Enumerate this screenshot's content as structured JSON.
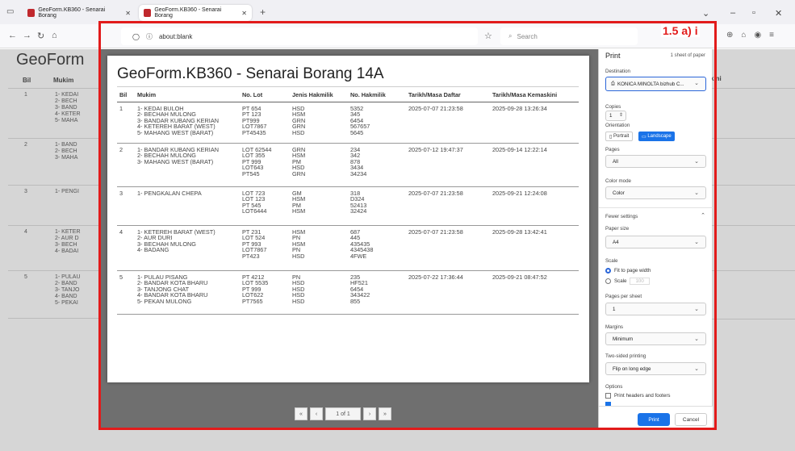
{
  "browser": {
    "tabs": [
      {
        "title": "GeoForm.KB360 - Senarai Borang"
      },
      {
        "title": "GeoForm.KB360 - Senarai Borang"
      }
    ],
    "url": "about:blank",
    "search_placeholder": "Search"
  },
  "background_page": {
    "title": "GeoForm",
    "headers": [
      "Bil",
      "Mukim"
    ],
    "right_header": "kini",
    "rows": [
      {
        "bil": "1",
        "mukim": [
          "1- KEDAI",
          "2- BECH",
          "3- BAND",
          "4- KETER",
          "5- MAHA"
        ]
      },
      {
        "bil": "2",
        "mukim": [
          "1- BAND",
          "2- BECH",
          "3- MAHA"
        ]
      },
      {
        "bil": "3",
        "mukim": [
          "1- PENGI"
        ]
      },
      {
        "bil": "4",
        "mukim": [
          "1- KETER",
          "2- AUR D",
          "3- BECH",
          "4- BADAI"
        ]
      },
      {
        "bil": "5",
        "mukim": [
          "1- PULAU",
          "2- BAND",
          "3- TANJO",
          "4- BAND",
          "5- PEKAI"
        ]
      }
    ]
  },
  "preview": {
    "title": "GeoForm.KB360 - Senarai Borang 14A",
    "columns": [
      "Bil",
      "Mukim",
      "No. Lot",
      "Jenis Hakmilik",
      "No. Hakmilik",
      "Tarikh/Masa Daftar",
      "Tarikh/Masa Kemaskini"
    ],
    "rows": [
      {
        "bil": "1",
        "mukim": [
          "1- KEDAI BULOH",
          "2- BECHAH MULONG",
          "3- BANDAR KUBANG KERIAN",
          "4- KETEREH BARAT (WEST)",
          "5- MAHANG WEST (BARAT)"
        ],
        "lot": [
          "PT 654",
          "PT 123",
          "PT999",
          "LOT7867",
          "PT45435"
        ],
        "jenis": [
          "HSD",
          "HSM",
          "GRN",
          "GRN",
          "HSD"
        ],
        "hakmilik": [
          "5352",
          "345",
          "6454",
          "567657",
          "5645"
        ],
        "daftar": "2025-07-07 21:23:58",
        "kemaskini": "2025-09-28 13:26:34"
      },
      {
        "bil": "2",
        "mukim": [
          "1- BANDAR KUBANG KERIAN",
          "2- BECHAH MULONG",
          "3- MAHANG WEST (BARAT)"
        ],
        "lot": [
          "LOT 62544",
          "LOT 355",
          "PT 999",
          "LOT643",
          "PT545"
        ],
        "jenis": [
          "GRN",
          "HSM",
          "PM",
          "HSD",
          "GRN"
        ],
        "hakmilik": [
          "234",
          "342",
          "878",
          "3434",
          "34234"
        ],
        "daftar": "2025-07-12 19:47:37",
        "kemaskini": "2025-09-14 12:22:14"
      },
      {
        "bil": "3",
        "mukim": [
          "1- PENGKALAN CHEPA"
        ],
        "lot": [
          "LOT 723",
          "LOT 123",
          "PT 545",
          "LOT6444"
        ],
        "jenis": [
          "GM",
          "HSM",
          "PM",
          "HSM"
        ],
        "hakmilik": [
          "318",
          "D324",
          "52413",
          "32424"
        ],
        "daftar": "2025-07-07 21:23:58",
        "kemaskini": "2025-09-21 12:24:08"
      },
      {
        "bil": "4",
        "mukim": [
          "1- KETEREH BARAT (WEST)",
          "2- AUR DURI",
          "3- BECHAH MULONG",
          "4- BADANG"
        ],
        "lot": [
          "PT 231",
          "LOT 524",
          "PT 993",
          "LOT7867",
          "PT423"
        ],
        "jenis": [
          "HSM",
          "PN",
          "HSM",
          "PN",
          "HSD"
        ],
        "hakmilik": [
          "687",
          "445",
          "435435",
          "4345438",
          "4FWE"
        ],
        "daftar": "2025-07-07 21:23:58",
        "kemaskini": "2025-09-28 13:42:41"
      },
      {
        "bil": "5",
        "mukim": [
          "1- PULAU PISANG",
          "2- BANDAR KOTA BHARU",
          "3- TANJONG CHAT",
          "4- BANDAR KOTA BHARU",
          "5- PEKAN MULONG"
        ],
        "lot": [
          "PT 4212",
          "LOT 5535",
          "PT 999",
          "LOT622",
          "PT7565"
        ],
        "jenis": [
          "PN",
          "HSD",
          "HSD",
          "HSD",
          "HSD"
        ],
        "hakmilik": [
          "235",
          "HF521",
          "6454",
          "343422",
          "855"
        ],
        "daftar": "2025-07-22 17:36:44",
        "kemaskini": "2025-09-21 08:47:52"
      }
    ],
    "pager": {
      "first": "«",
      "prev": "‹",
      "page": "1 of 1",
      "next": "›",
      "last": "»"
    }
  },
  "print_dialog": {
    "title": "Print",
    "sheet_count": "1 sheet of paper",
    "destination_label": "Destination",
    "destination_value": "KONICA MINOLTA bizhub C...",
    "copies_label": "Copies",
    "copies_value": "1",
    "orientation_label": "Orientation",
    "orientation_portrait": "Portrait",
    "orientation_landscape": "Landscape",
    "pages_label": "Pages",
    "pages_value": "All",
    "color_label": "Color mode",
    "color_value": "Color",
    "fewer_settings": "Fewer settings",
    "paper_label": "Paper size",
    "paper_value": "A4",
    "scale_label": "Scale",
    "scale_fit": "Fit to page width",
    "scale_custom": "Scale",
    "scale_custom_value": "100",
    "pps_label": "Pages per sheet",
    "pps_value": "1",
    "margins_label": "Margins",
    "margins_value": "Minimum",
    "twosided_label": "Two-sided printing",
    "twosided_value": "Flip on long edge",
    "options_label": "Options",
    "opt_headers": "Print headers and footers",
    "print_button": "Print",
    "cancel_button": "Cancel"
  },
  "annotation": {
    "label": "1.5 a) i",
    "color": "#e21b1b"
  }
}
